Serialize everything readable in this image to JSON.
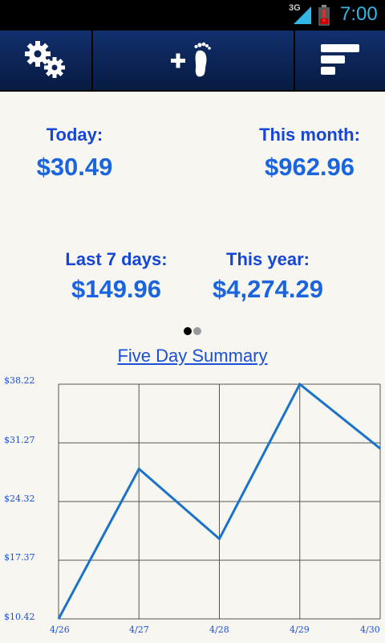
{
  "status_bar": {
    "network": "3G",
    "time": "7:00"
  },
  "action_bar": {
    "buttons": [
      {
        "icon": "gears-icon"
      },
      {
        "icon": "add-footprint-icon"
      },
      {
        "icon": "bars-chart-icon"
      }
    ]
  },
  "stats": {
    "today": {
      "label": "Today:",
      "value": "$30.49"
    },
    "month": {
      "label": "This month:",
      "value": "$962.96"
    },
    "week": {
      "label": "Last 7 days:",
      "value": "$149.96"
    },
    "year": {
      "label": "This year:",
      "value": "$4,274.29"
    }
  },
  "pager": {
    "active_index": 0,
    "count": 2
  },
  "summary_link": "Five Day Summary",
  "chart_data": {
    "type": "line",
    "title": "",
    "categories": [
      "4/26",
      "4/27",
      "4/28",
      "4/29",
      "4/30"
    ],
    "series": [
      {
        "values": [
          10.42,
          28.19,
          19.9,
          38.22,
          30.6
        ]
      }
    ],
    "y_ticks": [
      "$38.22",
      "$31.27",
      "$24.32",
      "$17.37",
      "$10.42"
    ],
    "ylim": [
      10.42,
      38.22
    ],
    "grid": true,
    "line_color": "#1a73c8"
  }
}
